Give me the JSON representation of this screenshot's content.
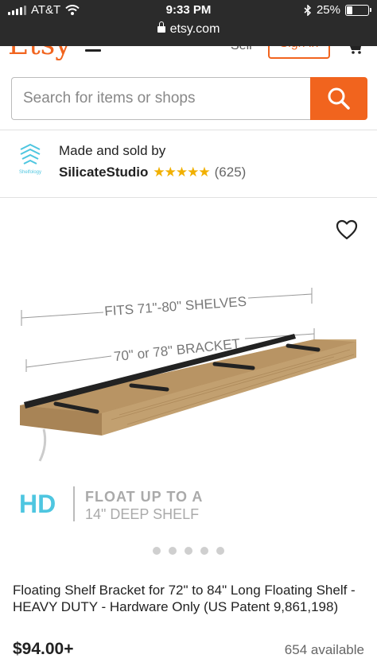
{
  "status_bar": {
    "carrier": "AT&T",
    "time": "9:33 PM",
    "battery": "25%",
    "battery_level": 0.25,
    "url": "etsy.com"
  },
  "header": {
    "logo": "Etsy",
    "peek_text": "Sell",
    "sign_in": "Sign in"
  },
  "search": {
    "placeholder": "Search for items or shops"
  },
  "seller": {
    "label": "Made and sold by",
    "name": "SilicateStudio",
    "stars": "★★★★★",
    "reviews": "(625)",
    "logo_text": "Shelfology"
  },
  "gallery": {
    "fits_label": "FITS 71\"-80\" SHELVES",
    "bracket_label": "70\" or 78\" BRACKET",
    "badge": "HD",
    "float_line1": "FLOAT UP TO A",
    "float_line2": "14\" DEEP SHELF",
    "dot_count": 5
  },
  "product": {
    "title": "Floating Shelf Bracket for 72\" to 84\" Long Floating Shelf - HEAVY DUTY - Hardware Only (US Patent 9,861,198)",
    "price": "$94.00+",
    "available": "654 available"
  },
  "colors": {
    "accent": "#f1641e",
    "star": "#f1b000",
    "hd": "#4ec6e0"
  }
}
